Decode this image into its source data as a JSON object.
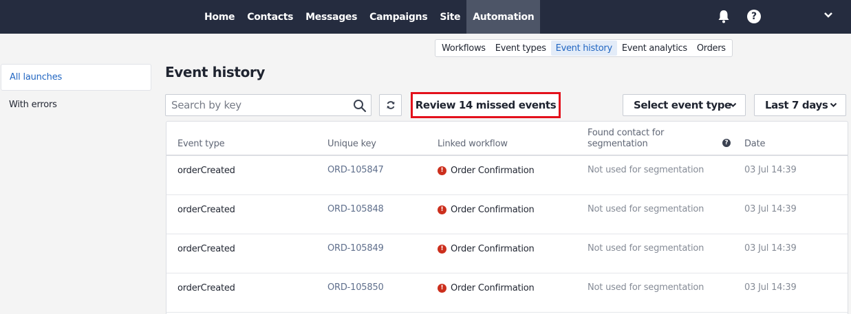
{
  "nav": {
    "items": [
      {
        "label": "Home"
      },
      {
        "label": "Contacts"
      },
      {
        "label": "Messages"
      },
      {
        "label": "Campaigns"
      },
      {
        "label": "Site"
      },
      {
        "label": "Automation",
        "active": true
      }
    ],
    "help_label": "?"
  },
  "subtabs": [
    {
      "label": "Workflows"
    },
    {
      "label": "Event types"
    },
    {
      "label": "Event history",
      "active": true
    },
    {
      "label": "Event analytics"
    },
    {
      "label": "Orders"
    }
  ],
  "sidebar": {
    "items": [
      {
        "label": "All launches",
        "active": true
      },
      {
        "label": "With errors"
      }
    ]
  },
  "page": {
    "title": "Event history"
  },
  "toolbar": {
    "search_placeholder": "Search by key",
    "review_label": "Review 14 missed events",
    "event_type_label": "Select event type",
    "period_label": "Last 7 days"
  },
  "table": {
    "headers": {
      "event_type": "Event type",
      "unique_key": "Unique key",
      "linked_workflow": "Linked workflow",
      "found_contact": "Found contact for segmentation",
      "help": "?",
      "date": "Date"
    },
    "rows": [
      {
        "event_type": "orderCreated",
        "unique_key": "ORD-105847",
        "workflow": "Order Confirmation",
        "workflow_status": "error",
        "segmentation": "Not used for segmentation",
        "date": "03 Jul 14:39"
      },
      {
        "event_type": "orderCreated",
        "unique_key": "ORD-105848",
        "workflow": "Order Confirmation",
        "workflow_status": "error",
        "segmentation": "Not used for segmentation",
        "date": "03 Jul 14:39"
      },
      {
        "event_type": "orderCreated",
        "unique_key": "ORD-105849",
        "workflow": "Order Confirmation",
        "workflow_status": "error",
        "segmentation": "Not used for segmentation",
        "date": "03 Jul 14:39"
      },
      {
        "event_type": "orderCreated",
        "unique_key": "ORD-105850",
        "workflow": "Order Confirmation",
        "workflow_status": "error",
        "segmentation": "Not used for segmentation",
        "date": "03 Jul 14:39"
      }
    ]
  },
  "colors": {
    "nav_bg": "#252c3f",
    "accent": "#2166c2",
    "highlight_border": "#e3101b",
    "error": "#cc2f1d"
  }
}
